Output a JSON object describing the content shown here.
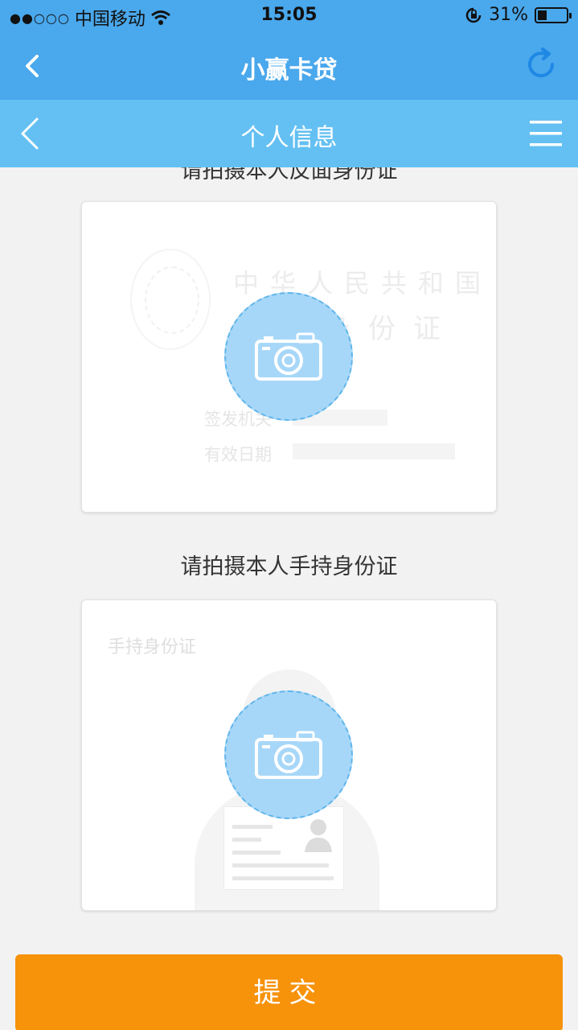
{
  "status_bar": {
    "signal_dots": "●●○○○",
    "carrier": "中国移动",
    "time": "15:05",
    "battery": "31%",
    "battery_level": 0.31
  },
  "app_bar": {
    "title": "小赢卡贷"
  },
  "sub_bar": {
    "title": "个人信息"
  },
  "sections": {
    "id_back_title": "请拍摄本人反面身份证",
    "id_back_card": {
      "line1": "中华人民共和国",
      "line2": "居民身份证",
      "issuer_label": "签发机关",
      "valid_label": "有效日期"
    },
    "hand_id_title": "请拍摄本人手持身份证",
    "hand_id_card": {
      "label": "手持身份证"
    }
  },
  "submit_label": "提交",
  "colors": {
    "header": "#4aa8ec",
    "sub_header": "#64c0f2",
    "camera_circle": "#a7d7f8",
    "submit": "#f7920b"
  }
}
